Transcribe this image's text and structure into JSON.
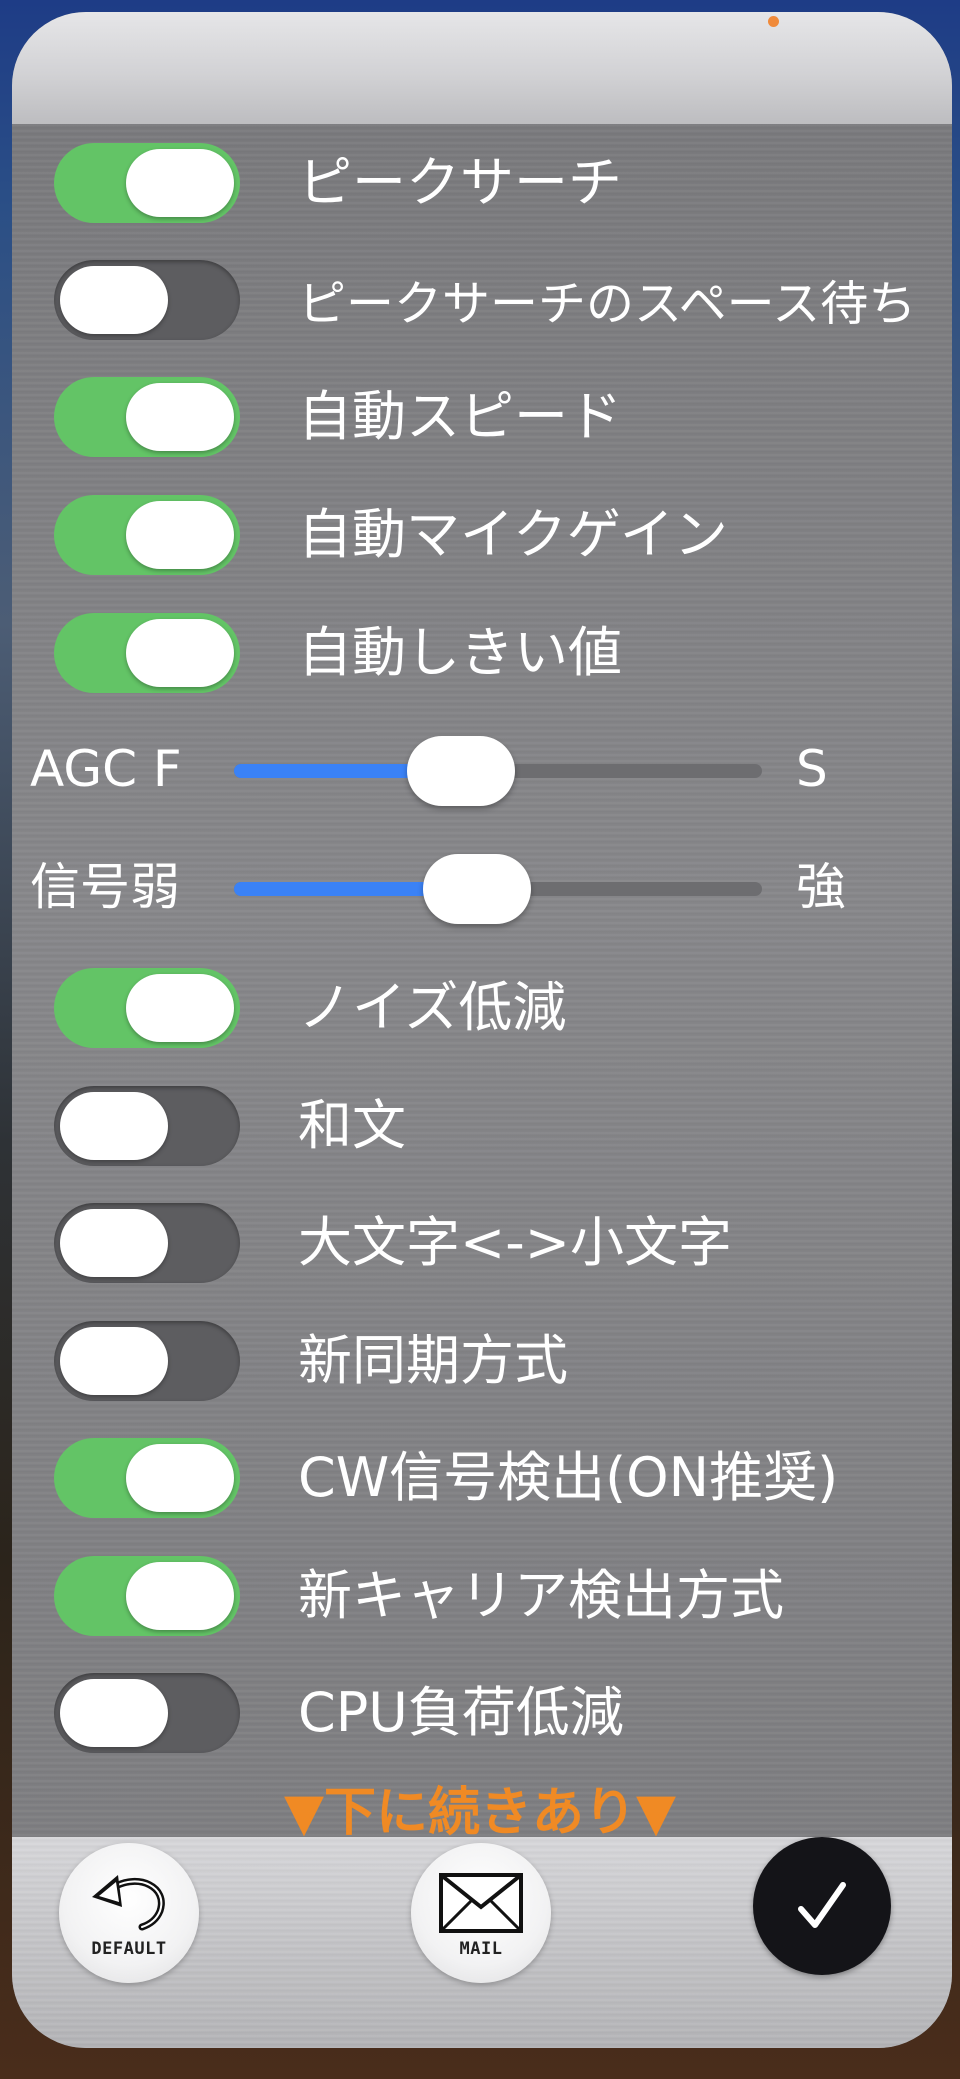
{
  "settings": {
    "toggles": [
      {
        "label": "ピークサーチ",
        "on": true
      },
      {
        "label": "ピークサーチのスペース待ち",
        "on": false
      },
      {
        "label": "自動スピード",
        "on": true
      },
      {
        "label": "自動マイクゲイン",
        "on": true
      },
      {
        "label": "自動しきい値",
        "on": true
      }
    ],
    "sliders": [
      {
        "left_label": "AGC F",
        "right_label": "S",
        "value": 0.43
      },
      {
        "left_label": "信号弱",
        "right_label": "強",
        "value": 0.46
      }
    ],
    "toggles2": [
      {
        "label": "ノイズ低減",
        "on": true
      },
      {
        "label": "和文",
        "on": false
      },
      {
        "label": "大文字<->小文字",
        "on": false
      },
      {
        "label": "新同期方式",
        "on": false
      },
      {
        "label": "CW信号検出(ON推奨)",
        "on": true
      },
      {
        "label": "新キャリア検出方式",
        "on": true
      },
      {
        "label": "CPU負荷低減",
        "on": false
      }
    ],
    "more_hint": "▼下に続きあり▼"
  },
  "bottom_bar": {
    "default_label": "DEFAULT",
    "mail_label": "MAIL",
    "default_icon": "undo-arrow-icon",
    "mail_icon": "envelope-icon",
    "confirm_icon": "checkmark-icon"
  },
  "colors": {
    "toggle_on": "#63c466",
    "toggle_off": "#5d5d60",
    "slider_fill": "#3b82f6",
    "hint": "#f08a24",
    "confirm_bg": "#141418"
  }
}
